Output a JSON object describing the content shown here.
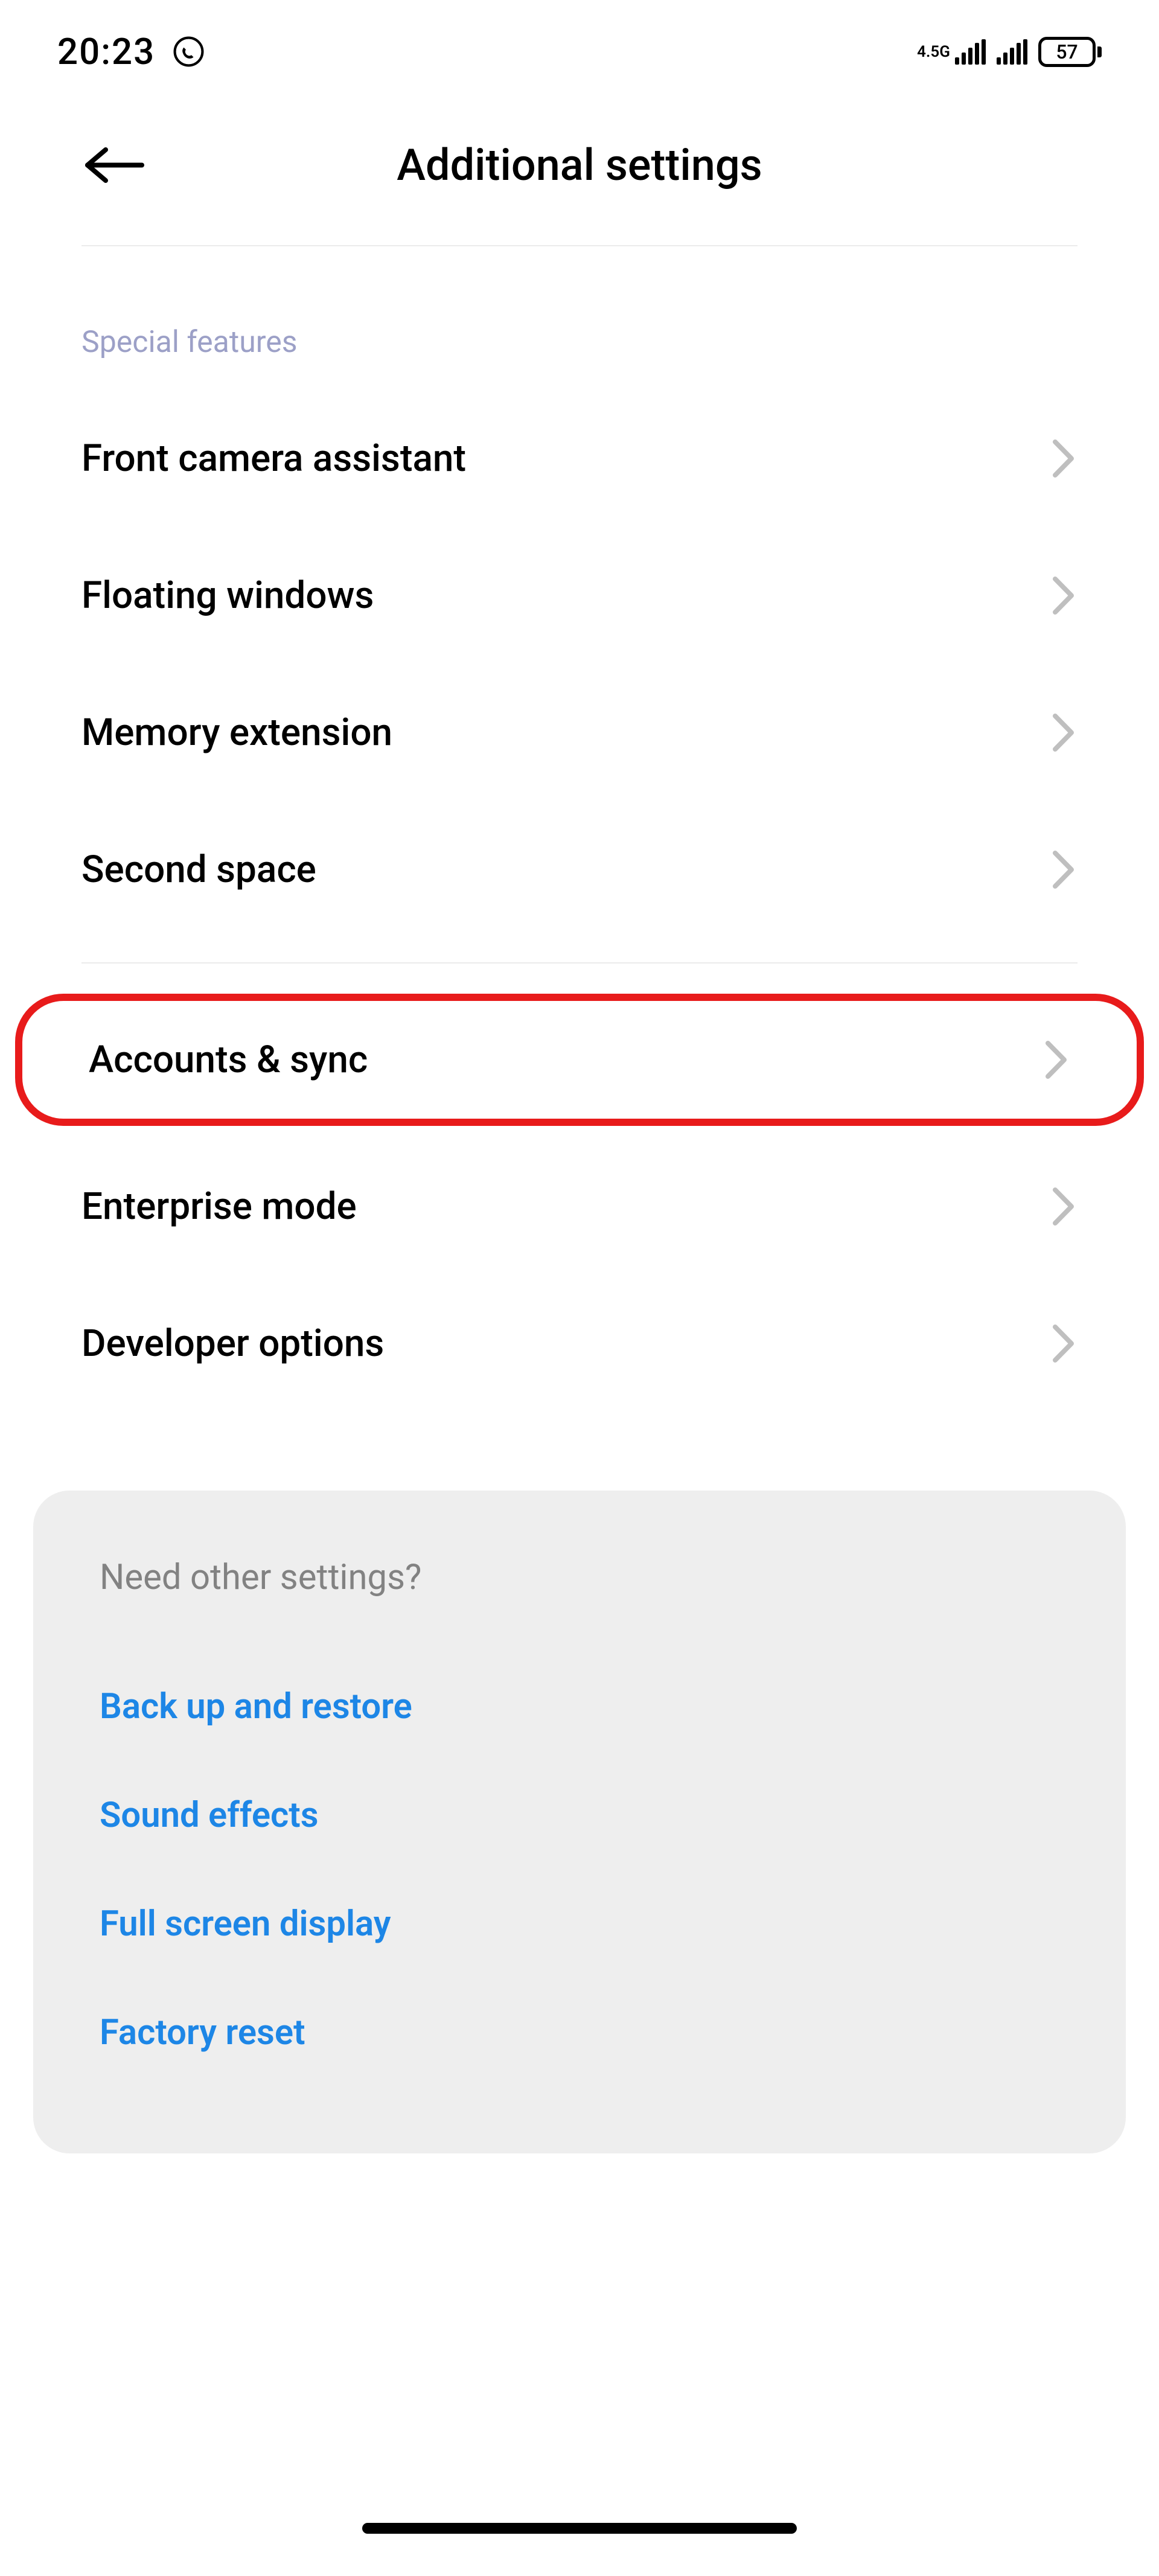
{
  "status_bar": {
    "time": "20:23",
    "network_label": "4.5G",
    "battery_percent": "57"
  },
  "header": {
    "title": "Additional settings"
  },
  "section1": {
    "header": "Special features",
    "items": [
      {
        "label": "Front camera assistant"
      },
      {
        "label": "Floating windows"
      },
      {
        "label": "Memory extension"
      },
      {
        "label": "Second space"
      }
    ]
  },
  "section2": {
    "items": [
      {
        "label": "Accounts & sync"
      },
      {
        "label": "Enterprise mode"
      },
      {
        "label": "Developer options"
      }
    ]
  },
  "other_settings": {
    "title": "Need other settings?",
    "links": [
      {
        "label": "Back up and restore"
      },
      {
        "label": "Sound effects"
      },
      {
        "label": "Full screen display"
      },
      {
        "label": "Factory reset"
      }
    ]
  }
}
